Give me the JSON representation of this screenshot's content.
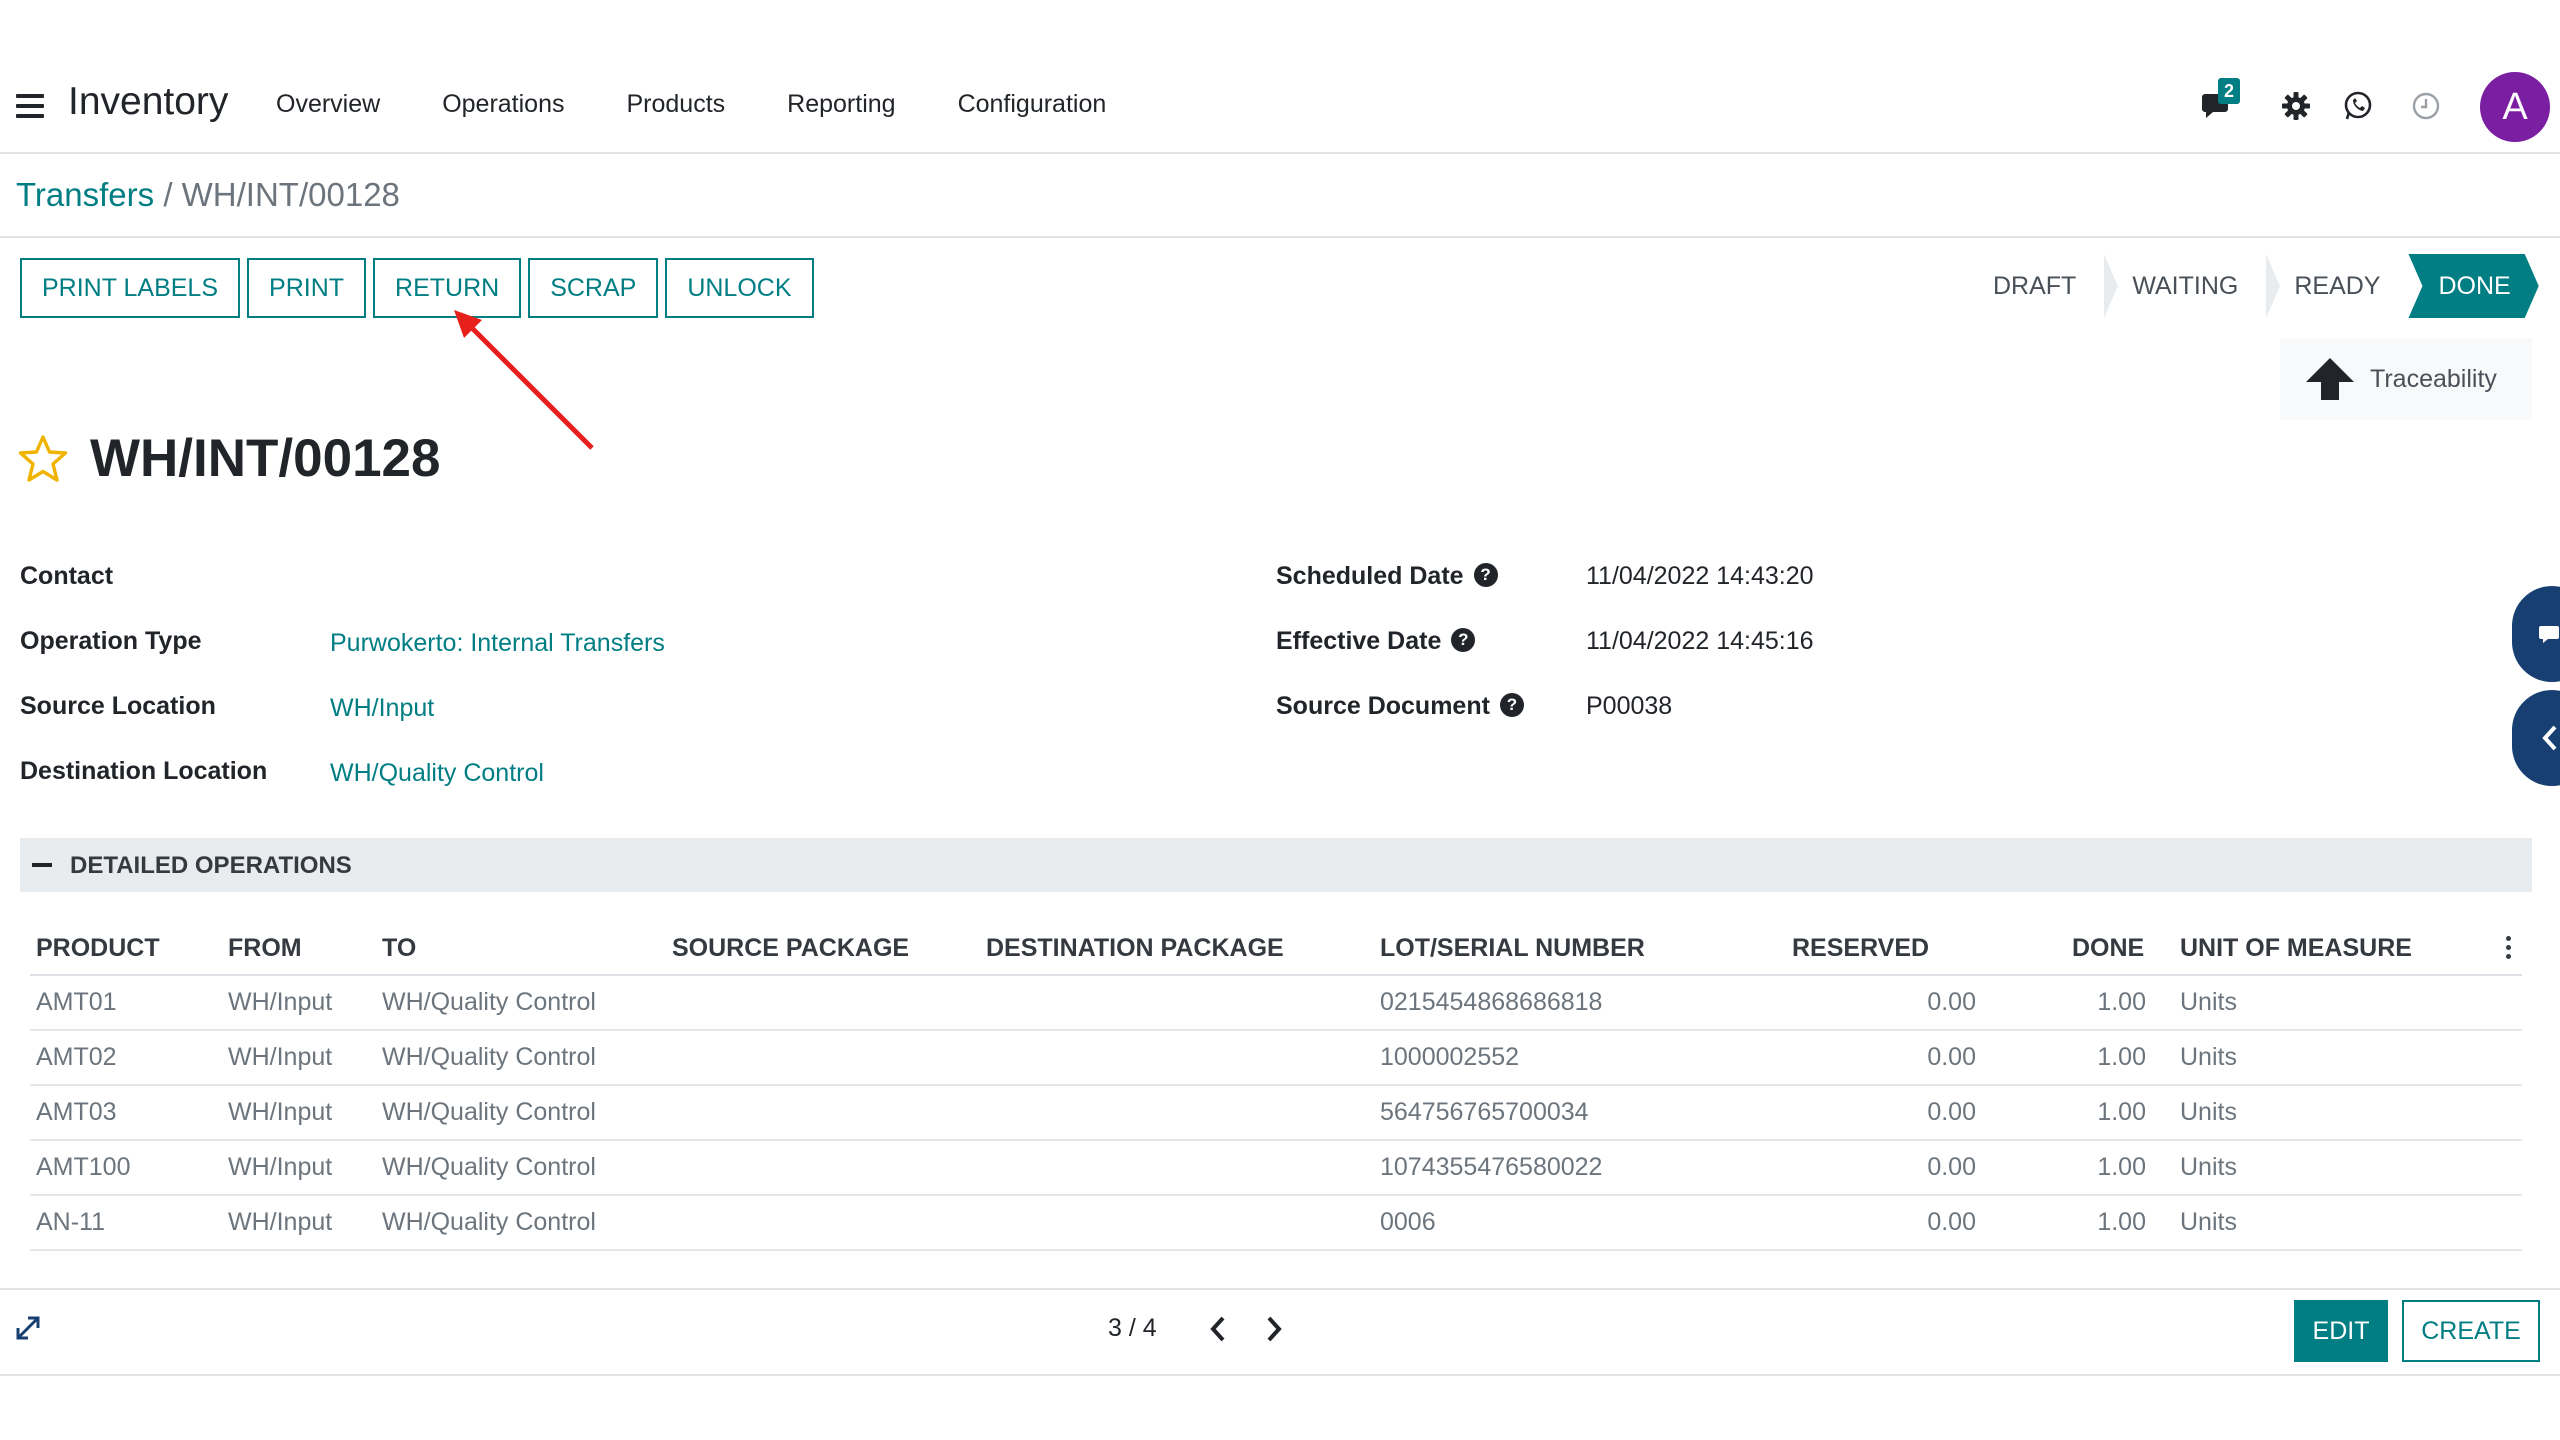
{
  "navbar": {
    "app_name": "Inventory",
    "menu": [
      "Overview",
      "Operations",
      "Products",
      "Reporting",
      "Configuration"
    ],
    "chat_badge": "2",
    "avatar_letter": "A",
    "icons": [
      "chat-icon",
      "gear-icon",
      "whatsapp-icon",
      "clock-icon"
    ]
  },
  "breadcrumb": {
    "parent": "Transfers",
    "separator": "/",
    "current": "WH/INT/00128"
  },
  "actions": {
    "print_labels": "PRINT LABELS",
    "print": "PRINT",
    "return": "RETURN",
    "scrap": "SCRAP",
    "unlock": "UNLOCK"
  },
  "status": {
    "stages": [
      "DRAFT",
      "WAITING",
      "READY",
      "DONE"
    ],
    "active": "DONE"
  },
  "traceability": {
    "label": "Traceability"
  },
  "record": {
    "title": "WH/INT/00128",
    "left_fields": [
      {
        "label": "Contact",
        "value": ""
      },
      {
        "label": "Operation Type",
        "value": "Purwokerto: Internal Transfers"
      },
      {
        "label": "Source Location",
        "value": "WH/Input"
      },
      {
        "label": "Destination Location",
        "value": "WH/Quality Control"
      }
    ],
    "right_fields": [
      {
        "label": "Scheduled Date",
        "value": "11/04/2022 14:43:20"
      },
      {
        "label": "Effective Date",
        "value": "11/04/2022 14:45:16"
      },
      {
        "label": "Source Document",
        "value": "P00038"
      }
    ]
  },
  "operations": {
    "section_title": "DETAILED OPERATIONS",
    "columns": [
      "PRODUCT",
      "FROM",
      "TO",
      "SOURCE PACKAGE",
      "DESTINATION PACKAGE",
      "LOT/SERIAL NUMBER",
      "RESERVED",
      "DONE",
      "UNIT OF MEASURE"
    ],
    "rows": [
      {
        "product": "AMT01",
        "from": "WH/Input",
        "to": "WH/Quality Control",
        "lot": "0215454868686818",
        "reserved": "0.00",
        "done": "1.00",
        "uom": "Units"
      },
      {
        "product": "AMT02",
        "from": "WH/Input",
        "to": "WH/Quality Control",
        "lot": "1000002552",
        "reserved": "0.00",
        "done": "1.00",
        "uom": "Units"
      },
      {
        "product": "AMT03",
        "from": "WH/Input",
        "to": "WH/Quality Control",
        "lot": "564756765700034",
        "reserved": "0.00",
        "done": "1.00",
        "uom": "Units"
      },
      {
        "product": "AMT100",
        "from": "WH/Input",
        "to": "WH/Quality Control",
        "lot": "1074355476580022",
        "reserved": "0.00",
        "done": "1.00",
        "uom": "Units"
      },
      {
        "product": "AN-11",
        "from": "WH/Input",
        "to": "WH/Quality Control",
        "lot": "0006",
        "reserved": "0.00",
        "done": "1.00",
        "uom": "Units"
      }
    ]
  },
  "pager": {
    "text": "3 / 4"
  },
  "footer": {
    "edit": "EDIT",
    "create": "CREATE"
  },
  "colors": {
    "accent": "#017e84",
    "annotation": "#e8201c",
    "avatar": "#7a1fa2",
    "side_button": "#173f72"
  }
}
